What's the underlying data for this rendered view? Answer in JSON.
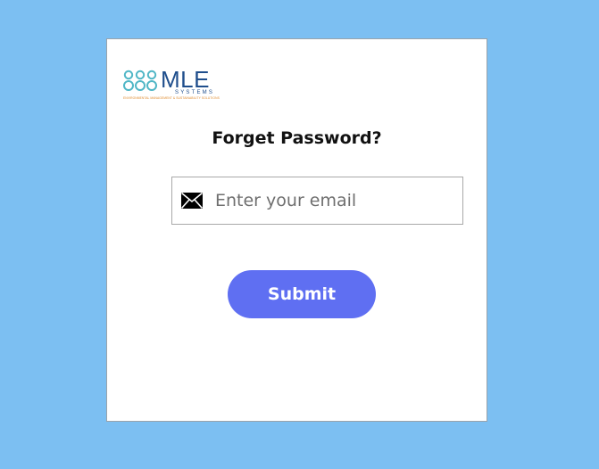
{
  "logo": {
    "brand": "MLE",
    "sub": "SYSTEMS",
    "tagline": "ENVIRONMENTAL MANAGEMENT & SUSTAINABILITY SOLUTIONS",
    "colors": {
      "rings": "#4fb6c6",
      "text": "#1f4e8c",
      "tagline": "#e08a2c"
    }
  },
  "heading": "Forget Password?",
  "email": {
    "icon": "envelope-icon",
    "placeholder": "Enter your email",
    "value": ""
  },
  "submit": {
    "label": "Submit",
    "color": "#5f6ff2"
  },
  "theme": {
    "background": "#7cbff2",
    "card": "#ffffff"
  }
}
